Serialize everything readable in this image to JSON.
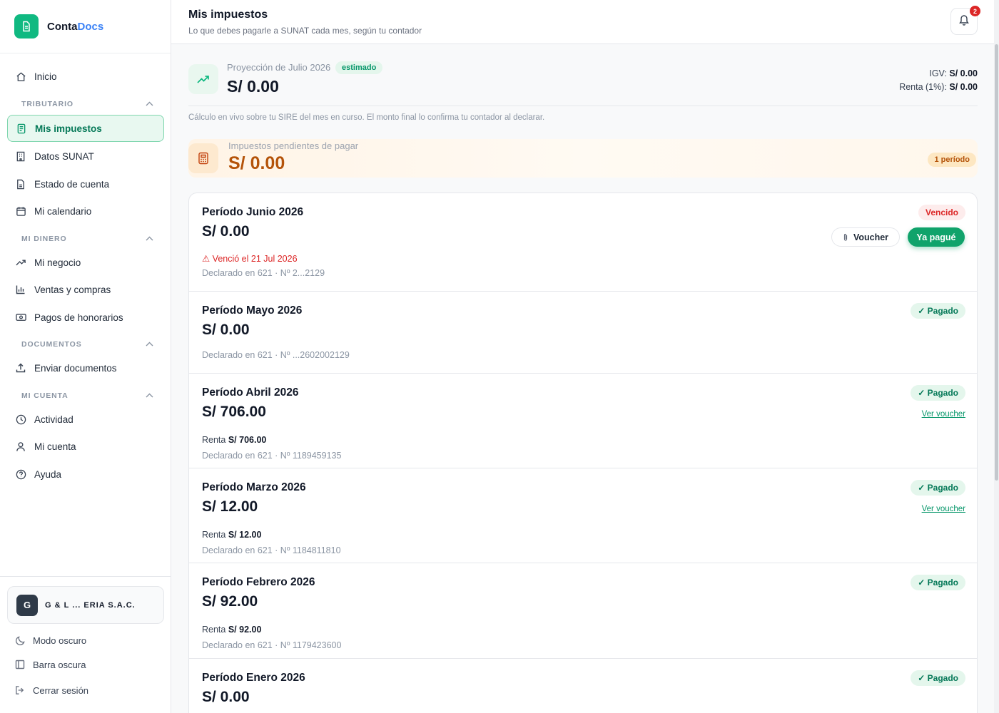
{
  "brand": {
    "name_part1": "Conta",
    "name_part2": "Docs"
  },
  "sidebar": {
    "home": "Inicio",
    "sections": {
      "tributario": "TRIBUTARIO",
      "mi_dinero": "MI DINERO",
      "documentos": "DOCUMENTOS",
      "mi_cuenta": "MI CUENTA"
    },
    "items": {
      "mis_impuestos": "Mis impuestos",
      "datos_sunat": "Datos SUNAT",
      "estado_cuenta": "Estado de cuenta",
      "mi_calendario": "Mi calendario",
      "mi_negocio": "Mi negocio",
      "ventas_compras": "Ventas y compras",
      "pagos_honorarios": "Pagos de honorarios",
      "enviar_documentos": "Enviar documentos",
      "actividad": "Actividad",
      "mi_cuenta": "Mi cuenta",
      "ayuda": "Ayuda"
    },
    "company": {
      "initial": "G",
      "name": "G & L ... ERIA S.A.C."
    },
    "footer": {
      "dark_mode": "Modo oscuro",
      "dark_bar": "Barra oscura",
      "logout": "Cerrar sesión"
    }
  },
  "header": {
    "title": "Mis impuestos",
    "subtitle": "Lo que debes pagarle a SUNAT cada mes, según tu contador",
    "notification_count": "2"
  },
  "projection": {
    "label": "Proyección de Julio 2026",
    "badge": "estimado",
    "amount": "S/ 0.00",
    "igv_label": "IGV:",
    "igv_value": "S/ 0.00",
    "renta_label": "Renta (1%):",
    "renta_value": "S/ 0.00",
    "note": "Cálculo en vivo sobre tu SIRE del mes en curso. El monto final lo confirma tu contador al declarar."
  },
  "pending": {
    "label": "Impuestos pendientes de pagar",
    "amount": "S/ 0.00",
    "badge": "1 período"
  },
  "periods": [
    {
      "title": "Período Junio 2026",
      "amount": "S/ 0.00",
      "warning": "⚠ Venció el 21 Jul 2026",
      "declared": "Declarado en 621 · Nº 2...2129",
      "status": "Vencido",
      "voucher_button": "Voucher",
      "paid_button": "Ya pagué"
    },
    {
      "title": "Período Mayo 2026",
      "amount": "S/ 0.00",
      "declared": "Declarado en 621 · Nº ...2602002129",
      "status": "✓ Pagado"
    },
    {
      "title": "Período Abril 2026",
      "amount": "S/ 706.00",
      "renta_label": "Renta",
      "renta_value": "S/ 706.00",
      "declared": "Declarado en 621 · Nº 1189459135",
      "status": "✓ Pagado",
      "link": "Ver voucher"
    },
    {
      "title": "Período Marzo 2026",
      "amount": "S/ 12.00",
      "renta_label": "Renta",
      "renta_value": "S/ 12.00",
      "declared": "Declarado en 621 · Nº 1184811810",
      "status": "✓ Pagado",
      "link": "Ver voucher"
    },
    {
      "title": "Período Febrero 2026",
      "amount": "S/ 92.00",
      "renta_label": "Renta",
      "renta_value": "S/ 92.00",
      "declared": "Declarado en 621 · Nº 1179423600",
      "status": "✓ Pagado"
    },
    {
      "title": "Período Enero 2026",
      "amount": "S/ 0.00",
      "status": "✓ Pagado"
    }
  ],
  "colors": {
    "brand_green": "#10b981",
    "accent_blue": "#3b82f6",
    "paid_green": "#047857",
    "overdue_red": "#dc2626",
    "pending_orange": "#b45309"
  }
}
